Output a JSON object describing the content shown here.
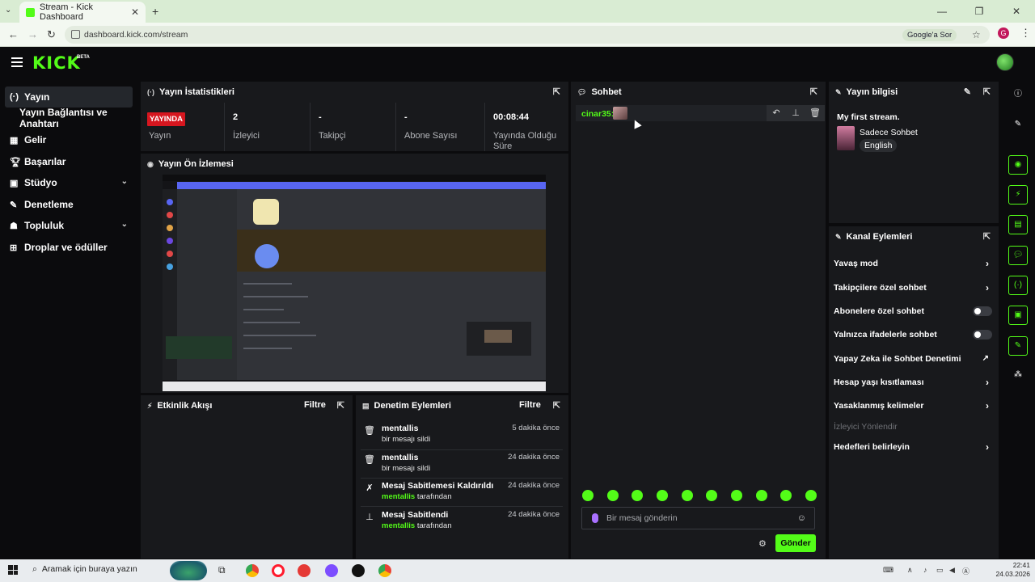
{
  "browser": {
    "tab_title": "Stream - Kick Dashboard",
    "url": "dashboard.kick.com/stream",
    "google_button": "Google'a Sor",
    "profile_initial": "G"
  },
  "app": {
    "logo": "KICK",
    "beta": "BETA"
  },
  "sidebar": {
    "items": [
      {
        "label": "Yayın",
        "icon": "broadcast-icon"
      },
      {
        "label": "Yayın Bağlantısı ve Anahtarı"
      },
      {
        "label": "Gelir",
        "icon": "chart-icon"
      },
      {
        "label": "Başarılar",
        "icon": "trophy-icon"
      },
      {
        "label": "Stüdyo",
        "icon": "studio-icon"
      },
      {
        "label": "Denetleme",
        "icon": "wrench-icon"
      },
      {
        "label": "Topluluk",
        "icon": "community-icon"
      },
      {
        "label": "Droplar ve ödüller",
        "icon": "gift-icon"
      }
    ]
  },
  "stats": {
    "title": "Yayın İstatistikleri",
    "live_badge": "YAYINDA",
    "items": [
      {
        "value": "",
        "label": "Yayın"
      },
      {
        "value": "2",
        "label": "İzleyici"
      },
      {
        "value": "-",
        "label": "Takipçi"
      },
      {
        "value": "-",
        "label": "Abone Sayısı"
      },
      {
        "value": "00:08:44",
        "label": "Yayında Olduğu Süre"
      }
    ]
  },
  "preview": {
    "title": "Yayın Ön İzlemesi"
  },
  "activity": {
    "title": "Etkinlik Akışı",
    "filter": "Filtre"
  },
  "moderation": {
    "title": "Denetim Eylemleri",
    "filter": "Filtre",
    "items": [
      {
        "title": "mentallis",
        "sub_user": "",
        "sub": "bir mesajı sildi",
        "time": "5 dakika önce",
        "icon": "trash-icon"
      },
      {
        "title": "mentallis",
        "sub_user": "",
        "sub": "bir mesajı sildi",
        "time": "24 dakika önce",
        "icon": "trash-icon"
      },
      {
        "title": "Mesaj Sabitlemesi Kaldırıldı",
        "sub_user": "mentallis",
        "sub": " tarafından",
        "time": "24 dakika önce",
        "icon": "unpin-icon"
      },
      {
        "title": "Mesaj Sabitlendi",
        "sub_user": "mentallis",
        "sub": " tarafından",
        "time": "24 dakika önce",
        "icon": "pin-icon"
      }
    ]
  },
  "chat": {
    "title": "Sohbet",
    "message_user": "cinar35:",
    "input_placeholder": "Bir mesaj gönderin",
    "send": "Gönder"
  },
  "stream_info": {
    "title": "Yayın bilgisi",
    "stream_title": "My first stream.",
    "category": "Sadece Sohbet",
    "language": "English"
  },
  "channel_actions": {
    "title": "Kanal Eylemleri",
    "items": [
      {
        "label": "Yavaş mod",
        "control": "arrow"
      },
      {
        "label": "Takipçilere özel sohbet",
        "control": "arrow"
      },
      {
        "label": "Abonelere özel sohbet",
        "control": "toggle",
        "on": false
      },
      {
        "label": "Yalnızca ifadelerle sohbet",
        "control": "toggle",
        "on": false
      },
      {
        "label": "Yapay Zeka ile Sohbet Denetimi",
        "control": "external"
      },
      {
        "label": "Hesap yaşı kısıtlaması",
        "control": "arrow"
      },
      {
        "label": "Yasaklanmış kelimeler",
        "control": "arrow"
      },
      {
        "label": "İzleyici Yönlendir",
        "control": "none",
        "disabled": true
      },
      {
        "label": "Hedefleri belirleyin",
        "control": "arrow"
      }
    ]
  },
  "taskbar": {
    "search": "Aramak için buraya yazın",
    "time": "22:41",
    "date": "24.03.2026"
  },
  "colors": {
    "accent": "#53fc18",
    "live": "#d6161f",
    "panel": "#18191c",
    "background": "#0b0b0d"
  }
}
